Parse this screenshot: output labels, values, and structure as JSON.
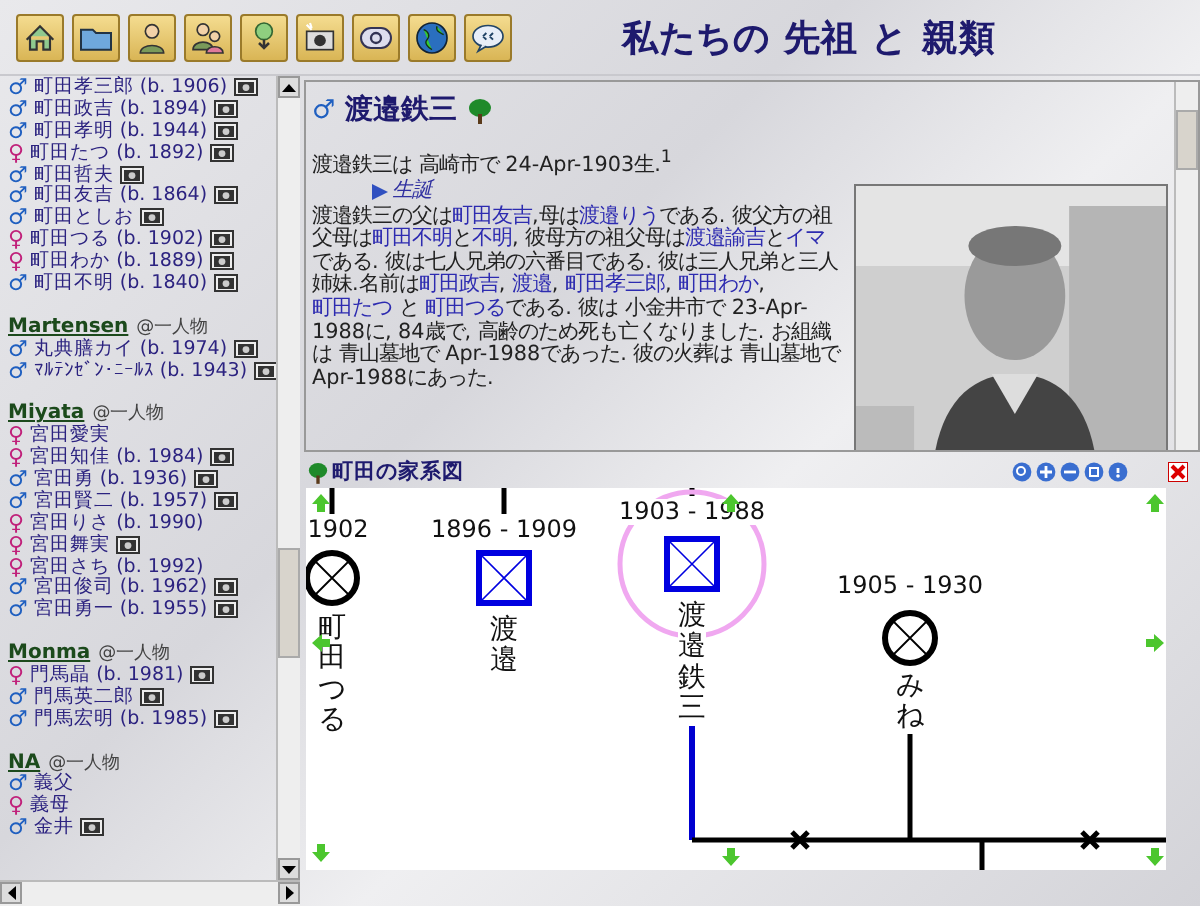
{
  "toolbar": {
    "buttons": [
      {
        "kind": "home"
      },
      {
        "kind": "folder"
      },
      {
        "kind": "person"
      },
      {
        "kind": "family"
      },
      {
        "kind": "tree-export"
      },
      {
        "kind": "camera"
      },
      {
        "kind": "email"
      },
      {
        "kind": "globe"
      },
      {
        "kind": "chat"
      }
    ]
  },
  "site_title": "私たちの 先祖 と 親類",
  "sidebar": {
    "groups": [
      {
        "people": [
          {
            "sex": "♂",
            "name": "町田孝三郎",
            "born": "(b. 1906)",
            "photo": true
          },
          {
            "sex": "♂",
            "name": "町田政吉",
            "born": "(b. 1894)",
            "photo": true
          },
          {
            "sex": "♂",
            "name": "町田孝明",
            "born": "(b. 1944)",
            "photo": true
          },
          {
            "sex": "♀",
            "name": "町田たつ",
            "born": "(b. 1892)",
            "photo": true
          },
          {
            "sex": "♂",
            "name": "町田哲夫",
            "photo": true
          },
          {
            "sex": "♂",
            "name": "町田友吉",
            "born": "(b. 1864)",
            "photo": true
          },
          {
            "sex": "♂",
            "name": "町田としお",
            "photo": true
          },
          {
            "sex": "♀",
            "name": "町田つる",
            "born": "(b. 1902)",
            "photo": true
          },
          {
            "sex": "♀",
            "name": "町田わか",
            "born": "(b. 1889)",
            "photo": true
          },
          {
            "sex": "♂",
            "name": "町田不明",
            "born": "(b. 1840)",
            "photo": true
          }
        ]
      },
      {
        "surname": "Martensen",
        "count": "@一人物",
        "people": [
          {
            "sex": "♂",
            "name": "丸典膳カイ",
            "born": "(b. 1974)",
            "photo": true
          },
          {
            "sex": "♂",
            "name": "ﾏﾙﾃﾝｾﾞﾝ･ﾆｰﾙｽ",
            "born": "(b. 1943)",
            "photo": true
          }
        ]
      },
      {
        "surname": "Miyata",
        "count": "@一人物",
        "people": [
          {
            "sex": "♀",
            "name": "宮田愛実",
            "photo": false
          },
          {
            "sex": "♀",
            "name": "宮田知佳",
            "born": "(b. 1984)",
            "photo": true
          },
          {
            "sex": "♂",
            "name": "宮田勇",
            "born": "(b. 1936)",
            "photo": true
          },
          {
            "sex": "♂",
            "name": "宮田賢二",
            "born": "(b. 1957)",
            "photo": true
          },
          {
            "sex": "♀",
            "name": "宮田りさ",
            "born": "(b. 1990)",
            "photo": false
          },
          {
            "sex": "♀",
            "name": "宮田舞実",
            "photo": true
          },
          {
            "sex": "♀",
            "name": "宮田さち",
            "born": "(b. 1992)",
            "photo": false
          },
          {
            "sex": "♂",
            "name": "宮田俊司",
            "born": "(b. 1962)",
            "photo": true
          },
          {
            "sex": "♂",
            "name": "宮田勇一",
            "born": "(b. 1955)",
            "photo": true
          }
        ]
      },
      {
        "surname": "Monma",
        "count": "@一人物",
        "people": [
          {
            "sex": "♀",
            "name": "門馬晶",
            "born": "(b. 1981)",
            "photo": true
          },
          {
            "sex": "♂",
            "name": "門馬英二郎",
            "photo": true
          },
          {
            "sex": "♂",
            "name": "門馬宏明",
            "born": "(b. 1985)",
            "photo": true
          }
        ]
      },
      {
        "surname": "NA",
        "count": "@一人物",
        "people": [
          {
            "sex": "♂",
            "name": "義父",
            "photo": false
          },
          {
            "sex": "♀",
            "name": "義母",
            "photo": false
          },
          {
            "sex": "♂",
            "name": "金井",
            "photo": true
          }
        ]
      }
    ]
  },
  "person": {
    "sex": "♂",
    "name": "渡邉鉄三",
    "birth_line": "渡邉鉄三は 高崎市で 24-Apr-1903生.$^{1}$",
    "section_link": "生誕",
    "paragraph": [
      {
        "text": "渡邉鉄三の父は"
      },
      {
        "text": "町田友吉",
        "link": true
      },
      {
        "text": ",母は"
      },
      {
        "text": "渡邉りう",
        "link": true
      },
      {
        "text": "である.  彼父方の祖父母は"
      },
      {
        "text": "町田不明",
        "link": true
      },
      {
        "text": "と"
      },
      {
        "text": "不明",
        "link": true
      },
      {
        "text": ", 彼母方の祖父母は"
      },
      {
        "text": "渡邉諭吉",
        "link": true
      },
      {
        "text": "と"
      },
      {
        "text": "イマ",
        "link": true
      },
      {
        "text": "である.  彼は七人兄弟の六番目である.  彼は三人兄弟と三人姉妹.名前は"
      },
      {
        "text": "町田政吉",
        "link": true
      },
      {
        "text": ", "
      },
      {
        "text": "渡邉",
        "link": true
      },
      {
        "text": ", "
      },
      {
        "text": "町田孝三郎",
        "link": true
      },
      {
        "text": ", "
      },
      {
        "text": "町田わか",
        "link": true
      },
      {
        "text": ", "
      },
      {
        "text": "町田たつ",
        "link": true
      },
      {
        "text": " と "
      },
      {
        "text": "町田つる",
        "link": true
      },
      {
        "text": "である.  彼は 小金井市で 23-Apr-1988に, 84歳で, 高齢のため死も亡くなりました.  お組織は 青山墓地で Apr-1988であった.  彼の火葬は 青山墓地で Apr-1988にあった."
      }
    ]
  },
  "tree": {
    "title": "町田の家系図",
    "nodes": [
      {
        "kind": "female",
        "years": "1902",
        "name": "町田つる",
        "selected": false
      },
      {
        "kind": "male",
        "years": "1896 - 1909",
        "name": "渡邉",
        "selected": false
      },
      {
        "kind": "male",
        "years": "1903 - 1988",
        "name": "渡邉鉄三",
        "selected": true
      },
      {
        "kind": "female",
        "years": "1905 - 1930",
        "name": "みね",
        "selected": false
      }
    ]
  }
}
